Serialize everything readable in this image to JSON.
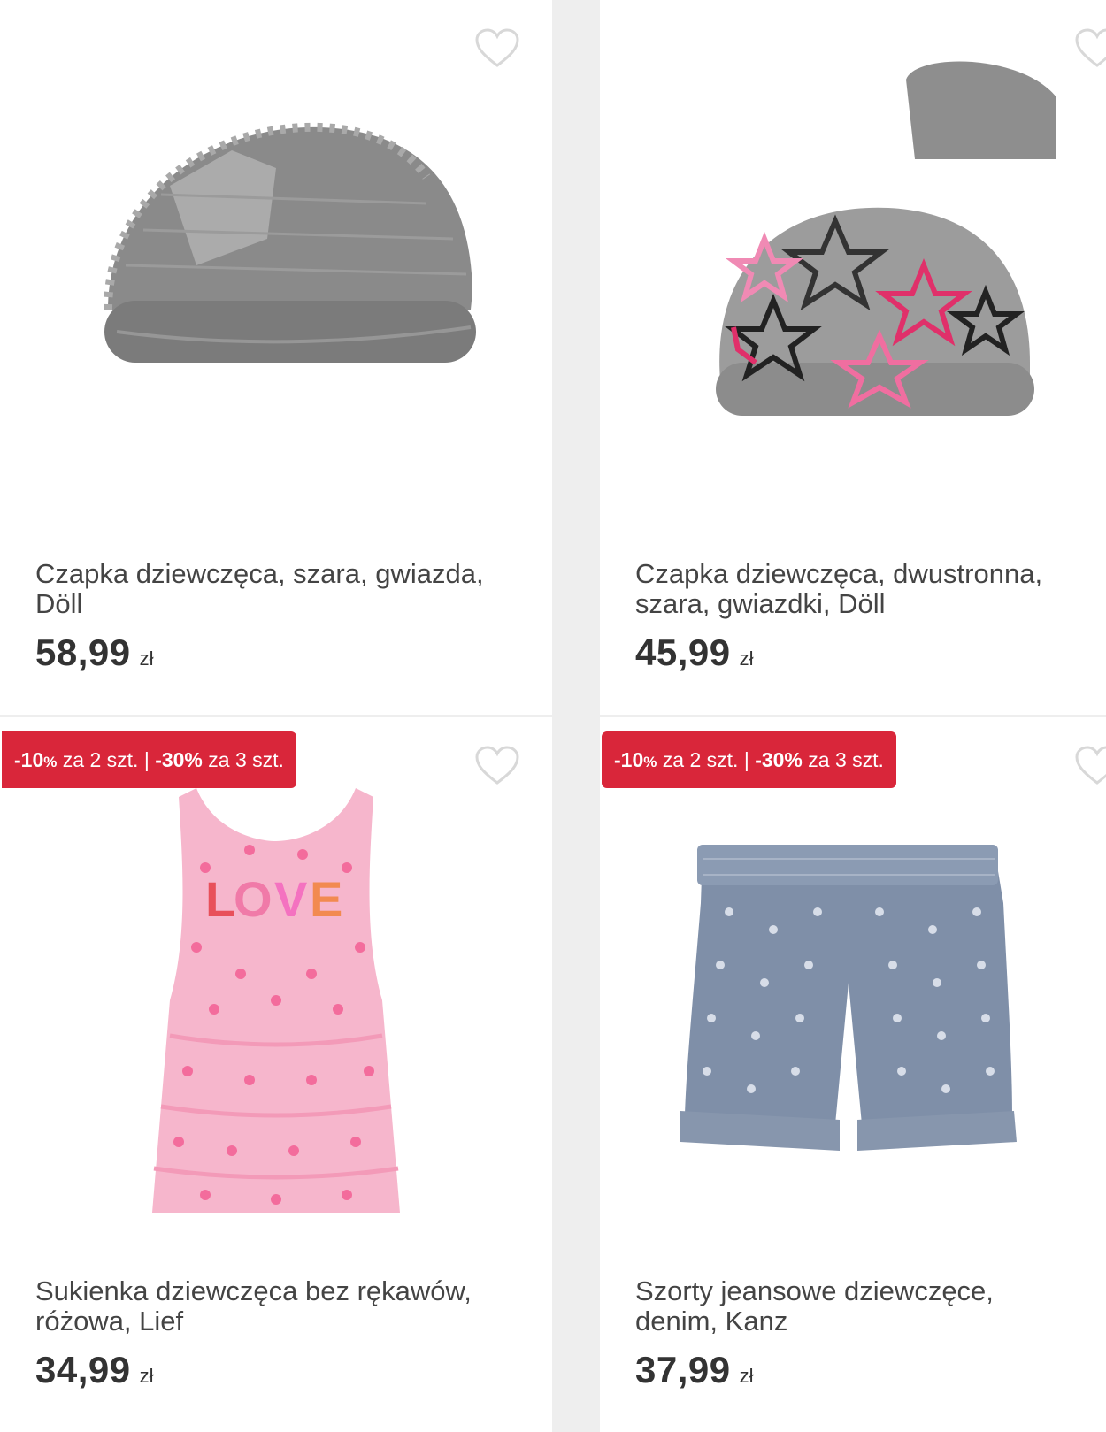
{
  "products": [
    {
      "title": "Czapka dziewczęca, szara, gwiazda, Döll",
      "price": "58,99",
      "currency": "zł",
      "image": "grey-knit-beanie-sequin-star",
      "badge": null
    },
    {
      "title": "Czapka dziewczęca, dwustronna, szara, gwiazdki, Döll",
      "price": "45,99",
      "currency": "zł",
      "image": "grey-beanie-pink-black-stars",
      "badge": null
    },
    {
      "title": "Sukienka dziewczęca bez rękawów, różowa, Lief",
      "price": "34,99",
      "currency": "zł",
      "image": "pink-cherry-dress-love",
      "badge": {
        "d1": "-10",
        "p1": "%",
        "t1": "za 2 szt.",
        "sep": "|",
        "d2": "-30%",
        "t2": "za 3 szt."
      }
    },
    {
      "title": "Szorty jeansowe dziewczęce, denim, Kanz",
      "price": "37,99",
      "currency": "zł",
      "image": "denim-polka-dot-shorts",
      "badge": {
        "d1": "-10",
        "p1": "%",
        "t1": "za 2 szt.",
        "sep": "|",
        "d2": "-30%",
        "t2": "za 3 szt."
      }
    }
  ],
  "icons": {
    "favorite": "heart-outline-icon"
  },
  "colors": {
    "badge": "#d9263a",
    "heart": "#d8d8d8",
    "text": "#444444"
  }
}
